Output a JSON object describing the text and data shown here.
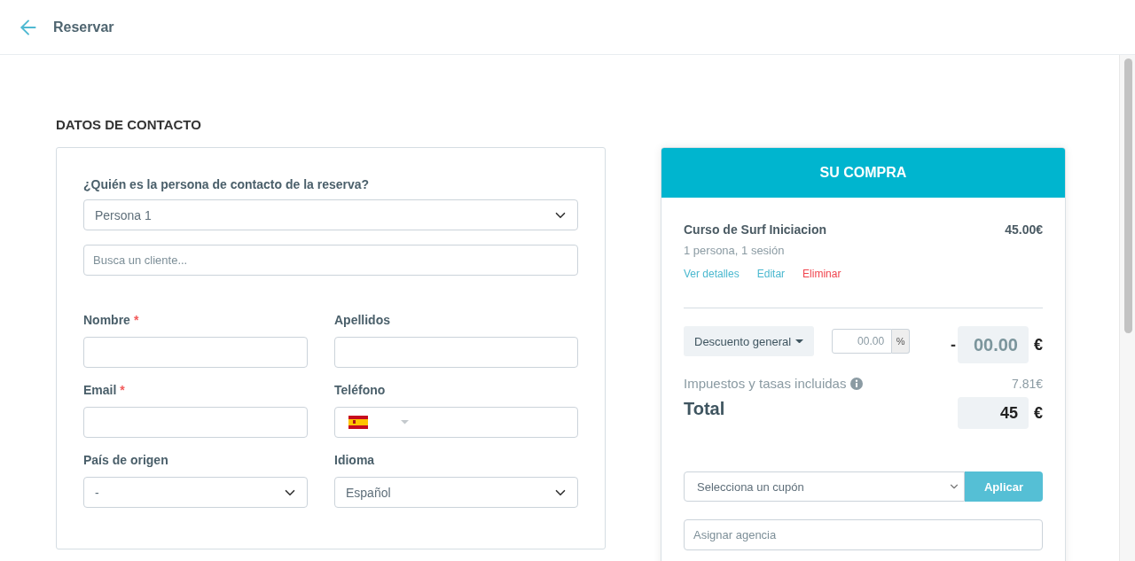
{
  "header": {
    "title": "Reservar"
  },
  "contact": {
    "heading": "DATOS DE CONTACTO",
    "required_mark": "*",
    "contact_person": {
      "label": "¿Quién es la persona de contacto de la reserva?",
      "value": "Persona 1"
    },
    "client_search": {
      "placeholder": "Busca un cliente..."
    },
    "fields": [
      {
        "kind": "text",
        "label": "Nombre",
        "required": true
      },
      {
        "kind": "text",
        "label": "Apellidos",
        "required": false
      },
      {
        "kind": "text",
        "label": "Email",
        "required": true
      },
      {
        "kind": "phone",
        "label": "Teléfono",
        "required": false
      },
      {
        "kind": "select",
        "label": "País de origen",
        "required": false,
        "value": "-"
      },
      {
        "kind": "select",
        "label": "Idioma",
        "required": false,
        "value": "Español"
      }
    ]
  },
  "purchase": {
    "title": "SU COMPRA",
    "items": [
      {
        "name": "Curso de Surf Iniciacion",
        "price": "45.00€",
        "details": "1 persona, 1 sesión",
        "actions": [
          {
            "kind": "link",
            "label": "Ver detalles"
          },
          {
            "kind": "link",
            "label": "Editar"
          },
          {
            "kind": "danger",
            "label": "Eliminar"
          }
        ]
      }
    ],
    "discount": {
      "type_label": "Descuento general",
      "percent_placeholder": "00.00",
      "percent_unit": "%",
      "sign": "-",
      "amount": "00.00",
      "currency": "€"
    },
    "taxes": {
      "label": "Impuestos y tasas incluidas",
      "value": "7.81€"
    },
    "total": {
      "label": "Total",
      "amount": "45",
      "currency": "€"
    },
    "coupon": {
      "value": "Selecciona un cupón",
      "button": "Aplicar"
    },
    "agency": {
      "placeholder": "Asignar agencia"
    }
  }
}
